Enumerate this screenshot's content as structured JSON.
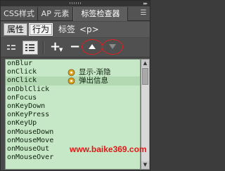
{
  "panel": {
    "tabs": [
      {
        "label": "CSS样式"
      },
      {
        "label": "AP 元素"
      },
      {
        "label": "标签检查器"
      }
    ],
    "subtabs": [
      {
        "label": "属性"
      },
      {
        "label": "行为"
      }
    ],
    "tag_label": "标签",
    "tag_name": "<p>"
  },
  "toolbar": {
    "show_set_events_icon": "list-icon",
    "show_all_events_icon": "list-all-icon",
    "add_label": "+",
    "remove_label": "−",
    "move_up_icon": "triangle-up",
    "move_down_icon": "triangle-down"
  },
  "events": [
    {
      "event": "onBlur",
      "action": ""
    },
    {
      "event": "onClick",
      "action": "显示-渐隐"
    },
    {
      "event": "onClick",
      "action": "弹出信息"
    },
    {
      "event": "onDblClick",
      "action": ""
    },
    {
      "event": "onFocus",
      "action": ""
    },
    {
      "event": "onKeyDown",
      "action": ""
    },
    {
      "event": "onKeyPress",
      "action": ""
    },
    {
      "event": "onKeyUp",
      "action": ""
    },
    {
      "event": "onMouseDown",
      "action": ""
    },
    {
      "event": "onMouseMove",
      "action": ""
    },
    {
      "event": "onMouseOut",
      "action": ""
    },
    {
      "event": "onMouseOver",
      "action": ""
    }
  ],
  "watermark": "www.baike369.com",
  "colors": {
    "panel_bg": "#4a4a4a",
    "list_bg": "#c6e8c6",
    "highlight_oval": "#e02020",
    "watermark": "#e01818"
  }
}
